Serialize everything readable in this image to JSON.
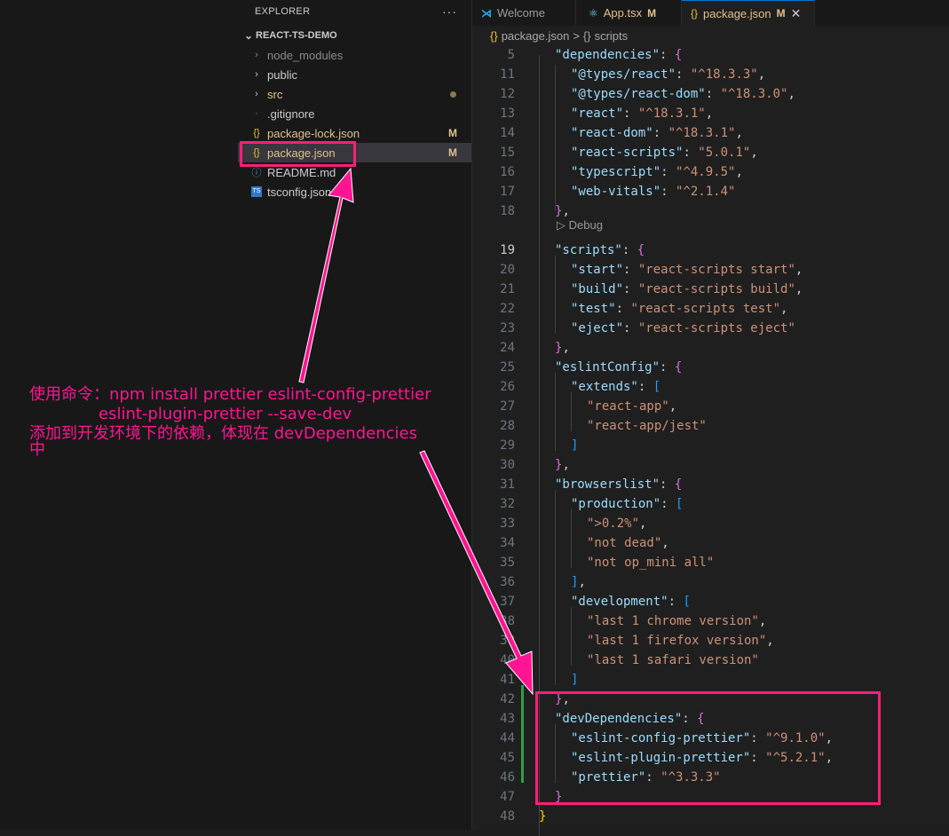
{
  "explorer": {
    "title": "EXPLORER",
    "more": "···",
    "project": "REACT-TS-DEMO",
    "items": [
      {
        "label": "node_modules",
        "type": "folder"
      },
      {
        "label": "public",
        "type": "folder"
      },
      {
        "label": "src",
        "type": "folder"
      },
      {
        "label": ".gitignore",
        "type": "file"
      },
      {
        "label": "package-lock.json",
        "type": "file",
        "badge": "M"
      },
      {
        "label": "package.json",
        "type": "file",
        "badge": "M"
      },
      {
        "label": "README.md",
        "type": "file"
      },
      {
        "label": "tsconfig.json",
        "type": "file"
      }
    ]
  },
  "tabs": [
    {
      "label": "Welcome",
      "icon": "vscode-icon"
    },
    {
      "label": "App.tsx",
      "icon": "react-icon",
      "mod": "M"
    },
    {
      "label": "package.json",
      "icon": "json-icon",
      "mod": "M",
      "close": "✕"
    }
  ],
  "breadcrumb": {
    "file": "package.json",
    "sep": ">",
    "section": "scripts",
    "file_icon": "{}",
    "section_icon": "{}"
  },
  "codelens": "Debug",
  "line_numbers": [
    "5",
    "11",
    "12",
    "13",
    "14",
    "15",
    "16",
    "17",
    "18",
    "19",
    "20",
    "21",
    "22",
    "23",
    "24",
    "25",
    "26",
    "27",
    "28",
    "29",
    "30",
    "31",
    "32",
    "33",
    "34",
    "35",
    "36",
    "37",
    "38",
    "39",
    "40",
    "41",
    "42",
    "43",
    "44",
    "45",
    "46",
    "47",
    "48"
  ],
  "code": {
    "l5": {
      "k": "\"dependencies\"",
      "p": ": ",
      "b": "{"
    },
    "l11": {
      "k": "\"@types/react\"",
      "p": ": ",
      "s": "\"^18.3.3\"",
      "e": ","
    },
    "l12": {
      "k": "\"@types/react-dom\"",
      "p": ": ",
      "s": "\"^18.3.0\"",
      "e": ","
    },
    "l13": {
      "k": "\"react\"",
      "p": ": ",
      "s": "\"^18.3.1\"",
      "e": ","
    },
    "l14": {
      "k": "\"react-dom\"",
      "p": ": ",
      "s": "\"^18.3.1\"",
      "e": ","
    },
    "l15": {
      "k": "\"react-scripts\"",
      "p": ": ",
      "s": "\"5.0.1\"",
      "e": ","
    },
    "l16": {
      "k": "\"typescript\"",
      "p": ": ",
      "s": "\"^4.9.5\"",
      "e": ","
    },
    "l17": {
      "k": "\"web-vitals\"",
      "p": ": ",
      "s": "\"^2.1.4\""
    },
    "l18": {
      "b": "}",
      "e": ","
    },
    "l19": {
      "k": "\"scripts\"",
      "p": ": ",
      "b": "{"
    },
    "l20": {
      "k": "\"start\"",
      "p": ": ",
      "s": "\"react-scripts start\"",
      "e": ","
    },
    "l21": {
      "k": "\"build\"",
      "p": ": ",
      "s": "\"react-scripts build\"",
      "e": ","
    },
    "l22": {
      "k": "\"test\"",
      "p": ": ",
      "s": "\"react-scripts test\"",
      "e": ","
    },
    "l23": {
      "k": "\"eject\"",
      "p": ": ",
      "s": "\"react-scripts eject\""
    },
    "l24": {
      "b": "}",
      "e": ","
    },
    "l25": {
      "k": "\"eslintConfig\"",
      "p": ": ",
      "b": "{"
    },
    "l26": {
      "k": "\"extends\"",
      "p": ": ",
      "b": "["
    },
    "l27": {
      "s": "\"react-app\"",
      "e": ","
    },
    "l28": {
      "s": "\"react-app/jest\""
    },
    "l29": {
      "b": "]"
    },
    "l30": {
      "b": "}",
      "e": ","
    },
    "l31": {
      "k": "\"browserslist\"",
      "p": ": ",
      "b": "{"
    },
    "l32": {
      "k": "\"production\"",
      "p": ": ",
      "b": "["
    },
    "l33": {
      "s": "\">0.2%\"",
      "e": ","
    },
    "l34": {
      "s": "\"not dead\"",
      "e": ","
    },
    "l35": {
      "s": "\"not op_mini all\""
    },
    "l36": {
      "b": "]",
      "e": ","
    },
    "l37": {
      "k": "\"development\"",
      "p": ": ",
      "b": "["
    },
    "l38": {
      "s": "\"last 1 chrome version\"",
      "e": ","
    },
    "l39": {
      "s": "\"last 1 firefox version\"",
      "e": ","
    },
    "l40": {
      "s": "\"last 1 safari version\""
    },
    "l41": {
      "b": "]"
    },
    "l42": {
      "b": "}",
      "e": ","
    },
    "l43": {
      "k": "\"devDependencies\"",
      "p": ": ",
      "b": "{"
    },
    "l44": {
      "k": "\"eslint-config-prettier\"",
      "p": ": ",
      "s": "\"^9.1.0\"",
      "e": ","
    },
    "l45": {
      "k": "\"eslint-plugin-prettier\"",
      "p": ": ",
      "s": "\"^5.2.1\"",
      "e": ","
    },
    "l46": {
      "k": "\"prettier\"",
      "p": ": ",
      "s": "\"^3.3.3\""
    },
    "l47": {
      "b": "}"
    },
    "l48": {
      "b": "}"
    }
  },
  "annotation": {
    "line1": "使用命令：npm install prettier eslint-config-prettier",
    "line2": "eslint-plugin-prettier --save-dev",
    "line3": "添加到开发环境下的依赖，体现在 devDependencies",
    "line4": "中"
  },
  "colors": {
    "annotation": "#ff1493",
    "highlight_box": "#ff1e78",
    "arrow": "#ff1493"
  }
}
